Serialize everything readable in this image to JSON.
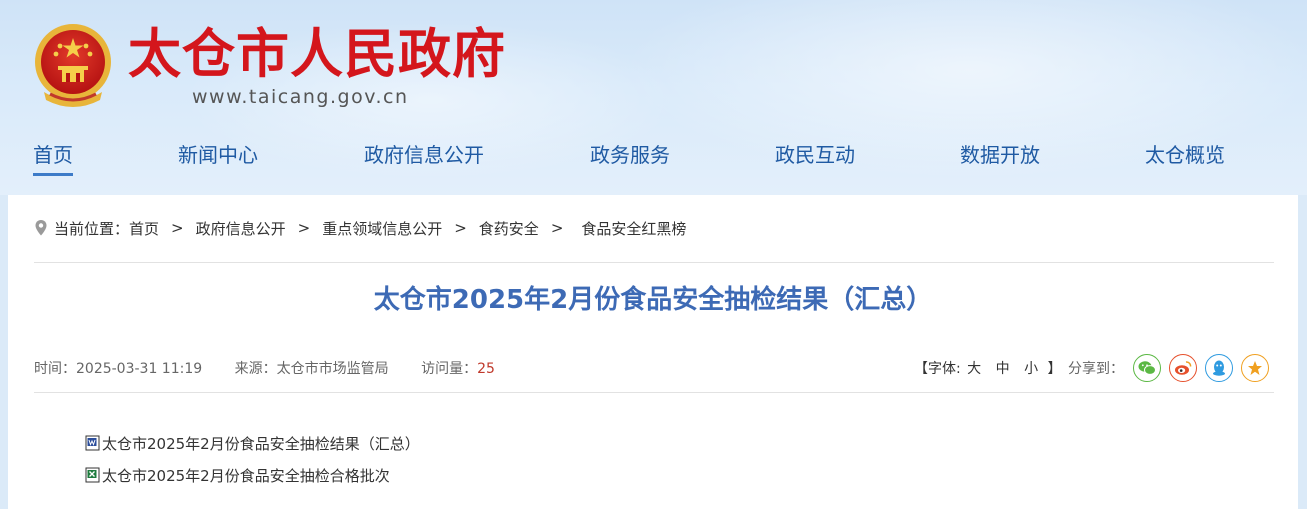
{
  "site": {
    "title": "太仓市人民政府",
    "url": "www.taicang.gov.cn"
  },
  "nav": {
    "items": [
      {
        "label": "首页",
        "active": true
      },
      {
        "label": "新闻中心"
      },
      {
        "label": "政府信息公开"
      },
      {
        "label": "政务服务"
      },
      {
        "label": "政民互动"
      },
      {
        "label": "数据开放"
      },
      {
        "label": "太仓概览"
      }
    ]
  },
  "breadcrumb": {
    "prefix": "当前位置：",
    "items": [
      "首页",
      "政府信息公开",
      "重点领域信息公开",
      "食药安全",
      "食品安全红黑榜"
    ],
    "separator": ">"
  },
  "article": {
    "title": "太仓市2025年2月份食品安全抽检结果（汇总）",
    "time": "时间：2025-03-31 11:19",
    "source": "来源：太仓市市场监管局",
    "visits_label": "访问量：",
    "visits": "25",
    "fontsize_open": "【字体:",
    "fontsize_options": [
      "大",
      "中",
      "小"
    ],
    "fontsize_close": "】",
    "share_label": "分享到："
  },
  "attachments": [
    {
      "name": "太仓市2025年2月份食品安全抽检结果（汇总）",
      "icon": "word-doc-icon"
    },
    {
      "name": "太仓市2025年2月份食品安全抽检合格批次",
      "icon": "excel-icon"
    }
  ],
  "colors": {
    "brand_red": "#d4161c",
    "nav_blue": "#1f5aa3",
    "title_blue": "#3d6ab5",
    "wechat": "#5bb844",
    "weibo": "#e6502c",
    "qq": "#2f9be0",
    "favorite": "#f0a020"
  }
}
